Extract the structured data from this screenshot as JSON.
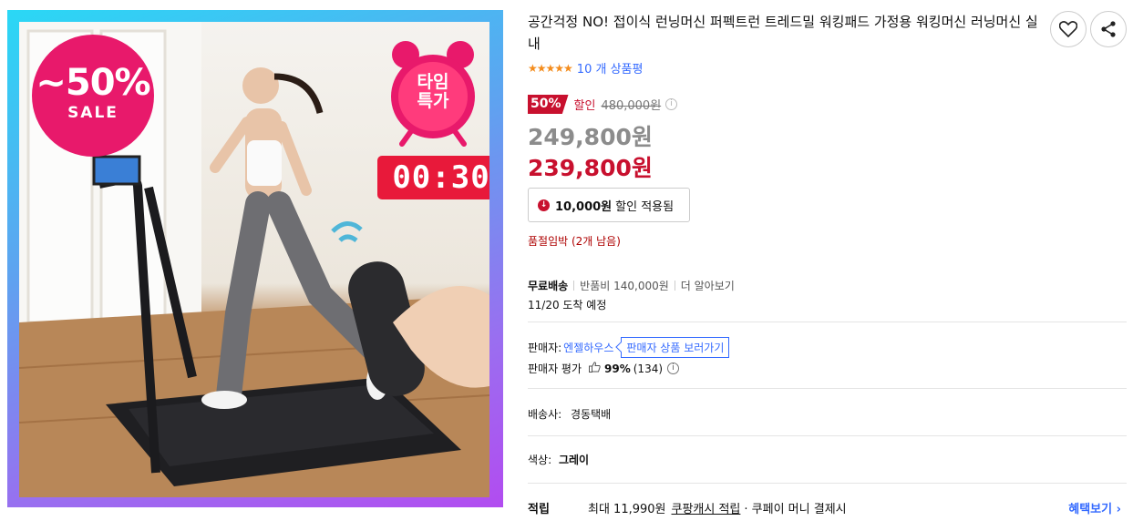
{
  "product": {
    "title": "공간걱정 NO! 접이식 런닝머신 퍼펙트런 트레드밀 워킹패드 가정용 워킹머신 러닝머신 실내",
    "image": {
      "sale_badge_pct": "~50%",
      "sale_badge_word": "SALE",
      "timer_label_line1": "타임",
      "timer_label_line2": "특가",
      "countdown": "00:30"
    }
  },
  "actions": {
    "wishlist_icon": "heart-icon",
    "share_icon": "share-icon"
  },
  "rating": {
    "stars": "★★★★★",
    "review_count": "10 개 상품평"
  },
  "pricing": {
    "discount_badge": "50%",
    "discount_label": "할인",
    "original_price": "480,000원",
    "sale_price": "249,800원",
    "final_price": "239,800원",
    "coupon_amount": "10,000원",
    "coupon_text": "할인 적용됨",
    "stock_warning": "품절임박 (2개 남음)"
  },
  "shipping": {
    "free_label": "무료배송",
    "return_fee": "반품비 140,000원",
    "learn_more": "더 알아보기",
    "arrival": "11/20 도착 예정"
  },
  "seller": {
    "label": "판매자:",
    "name": "엔젤하우스",
    "store_button": "판매자 상품 보러가기",
    "rating_label": "판매자 평가",
    "rating_pct": "99%",
    "rating_count": "(134)"
  },
  "carrier": {
    "label": "배송사:",
    "value": "경동택배"
  },
  "color": {
    "label": "색상:",
    "value": "그레이"
  },
  "reward": {
    "label": "적립",
    "text": "최대 11,990원",
    "cash": "쿠팡캐시 적립",
    "pay": "· 쿠페이 머니 결제시",
    "benefit_link": "혜택보기 ›"
  },
  "colors": {
    "accent_red": "#c8102e",
    "link_blue": "#346aff",
    "star_orange": "#f48c1c",
    "badge_pink": "#e8196b"
  }
}
